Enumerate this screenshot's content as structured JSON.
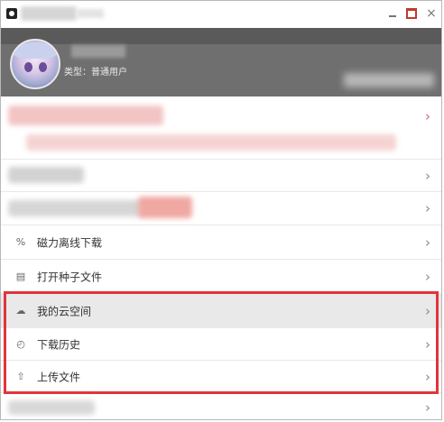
{
  "window": {
    "controls": {
      "minimize_icon": "minimize-icon",
      "maximize_icon": "maximize-icon",
      "close_icon": "close-icon",
      "close_glyph": "×"
    }
  },
  "profile": {
    "user_type": "类型：普通用户"
  },
  "menu": {
    "chevron": "›",
    "items": [
      {
        "icon": "magnet-link-icon",
        "glyph": "%",
        "label": "磁力离线下载"
      },
      {
        "icon": "torrent-file-icon",
        "glyph": "▤",
        "label": "打开种子文件"
      },
      {
        "icon": "cloud-icon",
        "glyph": "☁",
        "label": "我的云空间"
      },
      {
        "icon": "history-clock-icon",
        "glyph": "◴",
        "label": "下载历史"
      },
      {
        "icon": "upload-icon",
        "glyph": "⇧",
        "label": "上传文件"
      }
    ]
  },
  "colors": {
    "header_bg": "#6f6f6f",
    "highlight_border": "#e0353b",
    "selected_row_bg": "#e9e9e9"
  }
}
